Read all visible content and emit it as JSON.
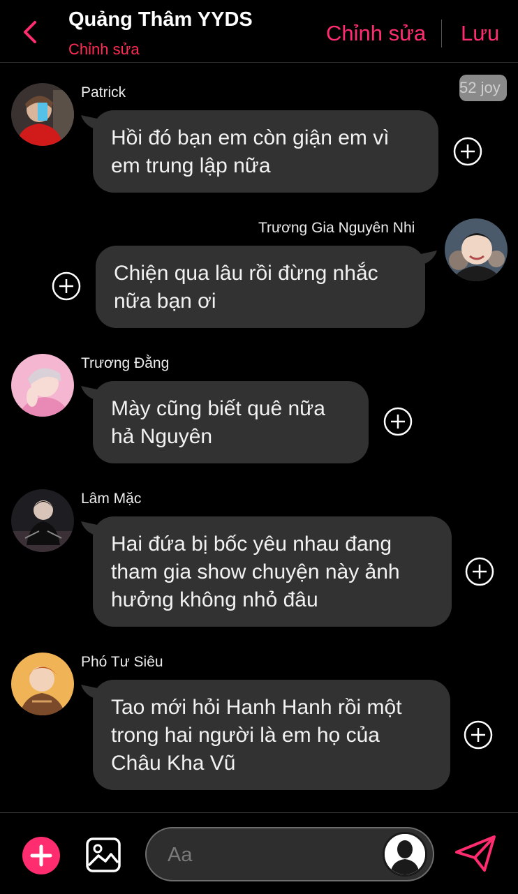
{
  "header": {
    "title": "Quảng Thâm YYDS",
    "subtitle": "Chỉnh sửa",
    "edit_label": "Chỉnh sửa",
    "save_label": "Lưu"
  },
  "badge": "52 joy",
  "messages": [
    {
      "sender": "Patrick",
      "text": "Hồi đó bạn em còn giận em vì em trung lập nữa",
      "side": "left"
    },
    {
      "sender": "Trương Gia Nguyên Nhi",
      "text": "Chiện qua lâu rồi đừng nhắc nữa bạn ơi",
      "side": "right"
    },
    {
      "sender": "Trương Đằng",
      "text": "Mày cũng biết quê nữa hả Nguyên",
      "side": "left"
    },
    {
      "sender": "Lâm Mặc",
      "text": "Hai đứa bị bốc yêu nhau đang tham gia show chuyện này ảnh hưởng không nhỏ đâu",
      "side": "left"
    },
    {
      "sender": "Phó Tư Siêu",
      "text": "Tao mới hỏi Hanh Hanh rồi một trong hai người là em họ của Châu Kha Vũ",
      "side": "left"
    }
  ],
  "composer": {
    "placeholder": "Aa"
  },
  "colors": {
    "accent": "#ff2d6f",
    "bubble": "#323232",
    "background": "#000000"
  },
  "icons": [
    "back-chevron-icon",
    "plus-circle-icon",
    "add-icon",
    "image-icon",
    "send-icon",
    "user-silhouette-icon"
  ]
}
